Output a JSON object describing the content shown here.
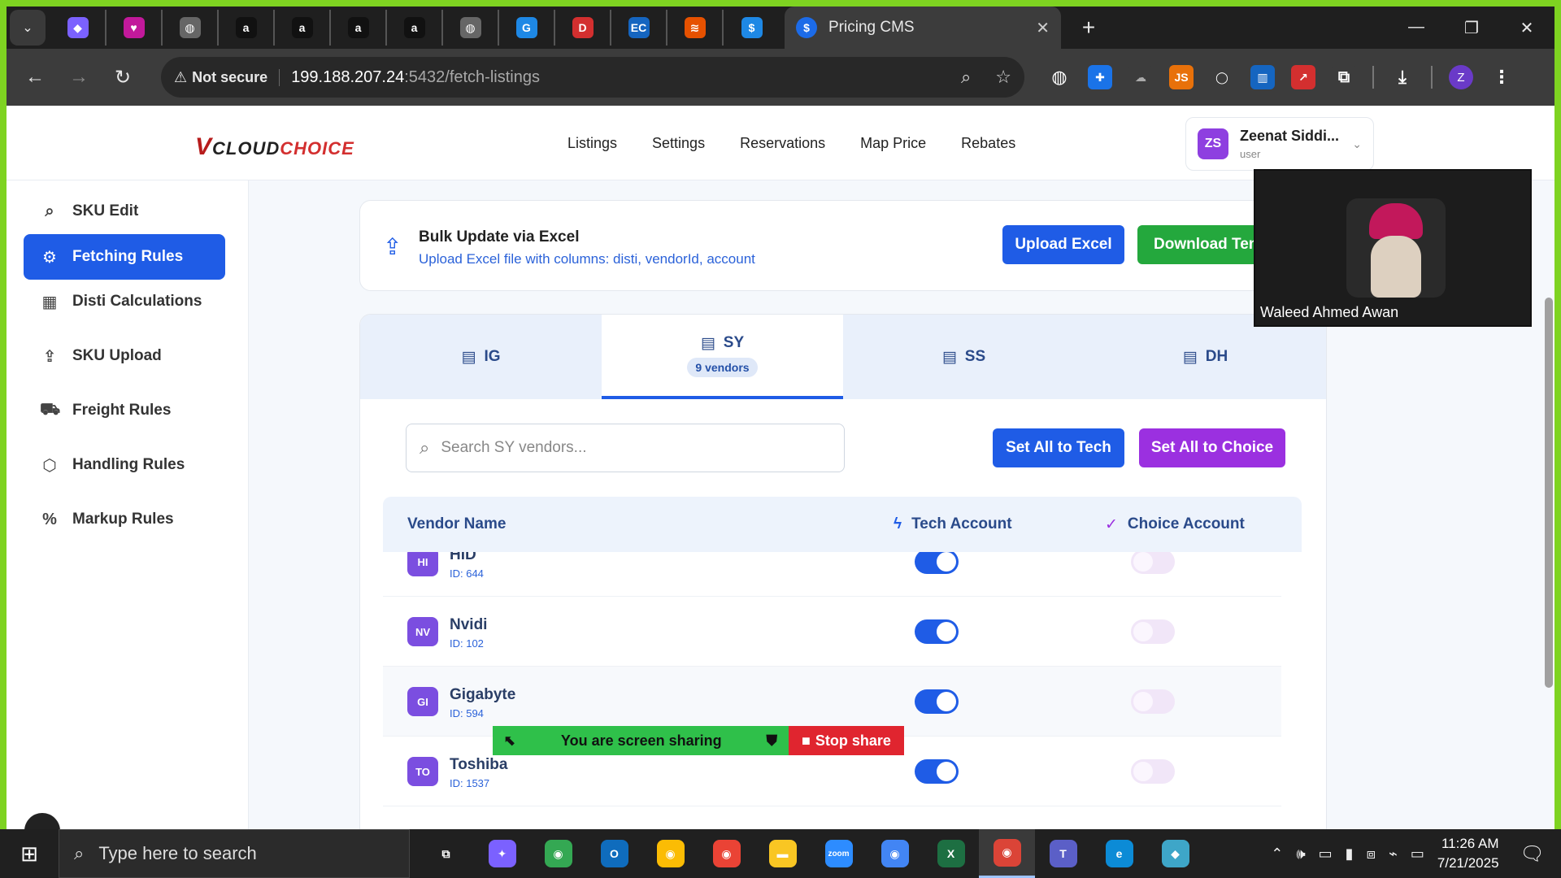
{
  "browser": {
    "active_tab_title": "Pricing CMS",
    "security_label": "Not secure",
    "url_host": "199.188.207.24",
    "url_rest": ":5432/fetch-listings",
    "pinned_tabs": [
      {
        "name": "box-icon",
        "glyph": "◆",
        "color": "#7b61ff"
      },
      {
        "name": "heart-app-icon",
        "glyph": "♥",
        "color": "#c2199b"
      },
      {
        "name": "globe-icon",
        "glyph": "◍",
        "color": "#666666"
      },
      {
        "name": "amazon-icon",
        "glyph": "a",
        "color": "#111111"
      },
      {
        "name": "amazon-icon",
        "glyph": "a",
        "color": "#111111"
      },
      {
        "name": "amazon-icon",
        "glyph": "a",
        "color": "#111111"
      },
      {
        "name": "amazon-icon",
        "glyph": "a",
        "color": "#111111"
      },
      {
        "name": "globe-icon",
        "glyph": "◍",
        "color": "#666666"
      },
      {
        "name": "g-app-icon",
        "glyph": "G",
        "color": "#1e88e5"
      },
      {
        "name": "dh-app-icon",
        "glyph": "D",
        "color": "#d32f2f"
      },
      {
        "name": "ec-app-icon",
        "glyph": "EC",
        "color": "#1565c0"
      },
      {
        "name": "stack-app-icon",
        "glyph": "≋",
        "color": "#e65100"
      },
      {
        "name": "dollar-app-icon",
        "glyph": "$",
        "color": "#1e88e5"
      }
    ]
  },
  "app": {
    "logo_v": "V",
    "logo_part1": "CLOUD",
    "logo_part2": "CHOICE",
    "menu": [
      "Listings",
      "Settings",
      "Reservations",
      "Map Price",
      "Rebates"
    ],
    "user": {
      "initials": "ZS",
      "name": "Zeenat Siddi...",
      "role": "user"
    }
  },
  "sidebar": {
    "items": [
      {
        "label": "SKU Edit",
        "icon": "⌕",
        "active": false
      },
      {
        "label": "Fetching Rules",
        "icon": "⚙",
        "active": true
      },
      {
        "label": "Disti Calculations",
        "icon": "▦",
        "active": false
      },
      {
        "label": "SKU Upload",
        "icon": "⇪",
        "active": false
      },
      {
        "label": "Freight Rules",
        "icon": "⛟",
        "active": false
      },
      {
        "label": "Handling Rules",
        "icon": "⬡",
        "active": false
      },
      {
        "label": "Markup Rules",
        "icon": "%",
        "active": false
      }
    ]
  },
  "bulk": {
    "title": "Bulk Update via Excel",
    "subtitle": "Upload Excel file with columns: disti, vendorId, account",
    "upload_label": "Upload Excel",
    "download_label": "Download Temp"
  },
  "tabs": [
    {
      "label": "IG",
      "active": false,
      "badge": ""
    },
    {
      "label": "SY",
      "active": true,
      "badge": "9 vendors"
    },
    {
      "label": "SS",
      "active": false,
      "badge": ""
    },
    {
      "label": "DH",
      "active": false,
      "badge": ""
    }
  ],
  "vendors_panel": {
    "search_placeholder": "Search SY vendors...",
    "set_tech_label": "Set All to Tech",
    "set_choice_label": "Set All to Choice",
    "col_vendor": "Vendor Name",
    "col_tech": "Tech Account",
    "col_choice": "Choice Account"
  },
  "vendors": [
    {
      "initials": "HI",
      "name": "HID",
      "id": "ID: 644",
      "tech": true,
      "choice": false
    },
    {
      "initials": "NV",
      "name": "Nvidi",
      "id": "ID: 102",
      "tech": true,
      "choice": false
    },
    {
      "initials": "GI",
      "name": "Gigabyte",
      "id": "ID: 594",
      "tech": true,
      "choice": false
    },
    {
      "initials": "TO",
      "name": "Toshiba",
      "id": "ID: 1537",
      "tech": true,
      "choice": false
    }
  ],
  "screen_share": {
    "message": "You are screen sharing",
    "stop_label": "Stop share"
  },
  "video": {
    "participant": "Waleed Ahmed Awan"
  },
  "taskbar": {
    "search_placeholder": "Type here to search",
    "apps": [
      {
        "name": "task-view-icon",
        "glyph": "⧉",
        "color": "#202020",
        "active": false
      },
      {
        "name": "copilot-icon",
        "glyph": "✦",
        "color": "#7b61ff",
        "active": false
      },
      {
        "name": "chrome-profile-icon",
        "glyph": "◉",
        "color": "#34a853",
        "active": false
      },
      {
        "name": "outlook-icon",
        "glyph": "O",
        "color": "#0f6cbd",
        "active": false
      },
      {
        "name": "chrome-profile-icon",
        "glyph": "◉",
        "color": "#fbbc04",
        "active": false
      },
      {
        "name": "chrome-profile-icon",
        "glyph": "◉",
        "color": "#ea4335",
        "active": false
      },
      {
        "name": "file-explorer-icon",
        "glyph": "▬",
        "color": "#f9c623",
        "active": false
      },
      {
        "name": "zoom-icon",
        "glyph": "zoom",
        "color": "#2d8cff",
        "active": false
      },
      {
        "name": "chrome-icon",
        "glyph": "◉",
        "color": "#4285f4",
        "active": false
      },
      {
        "name": "excel-icon",
        "glyph": "X",
        "color": "#1d6f42",
        "active": false
      },
      {
        "name": "chrome-profile-icon",
        "glyph": "◉",
        "color": "#db4437",
        "active": true
      },
      {
        "name": "teams-icon",
        "glyph": "T",
        "color": "#5b5fc7",
        "active": false
      },
      {
        "name": "edge-icon",
        "glyph": "e",
        "color": "#0c8bd6",
        "active": false
      },
      {
        "name": "app-diamond-icon",
        "glyph": "◆",
        "color": "#3ea6c8",
        "active": false
      }
    ],
    "time": "11:26 AM",
    "date": "7/21/2025"
  }
}
